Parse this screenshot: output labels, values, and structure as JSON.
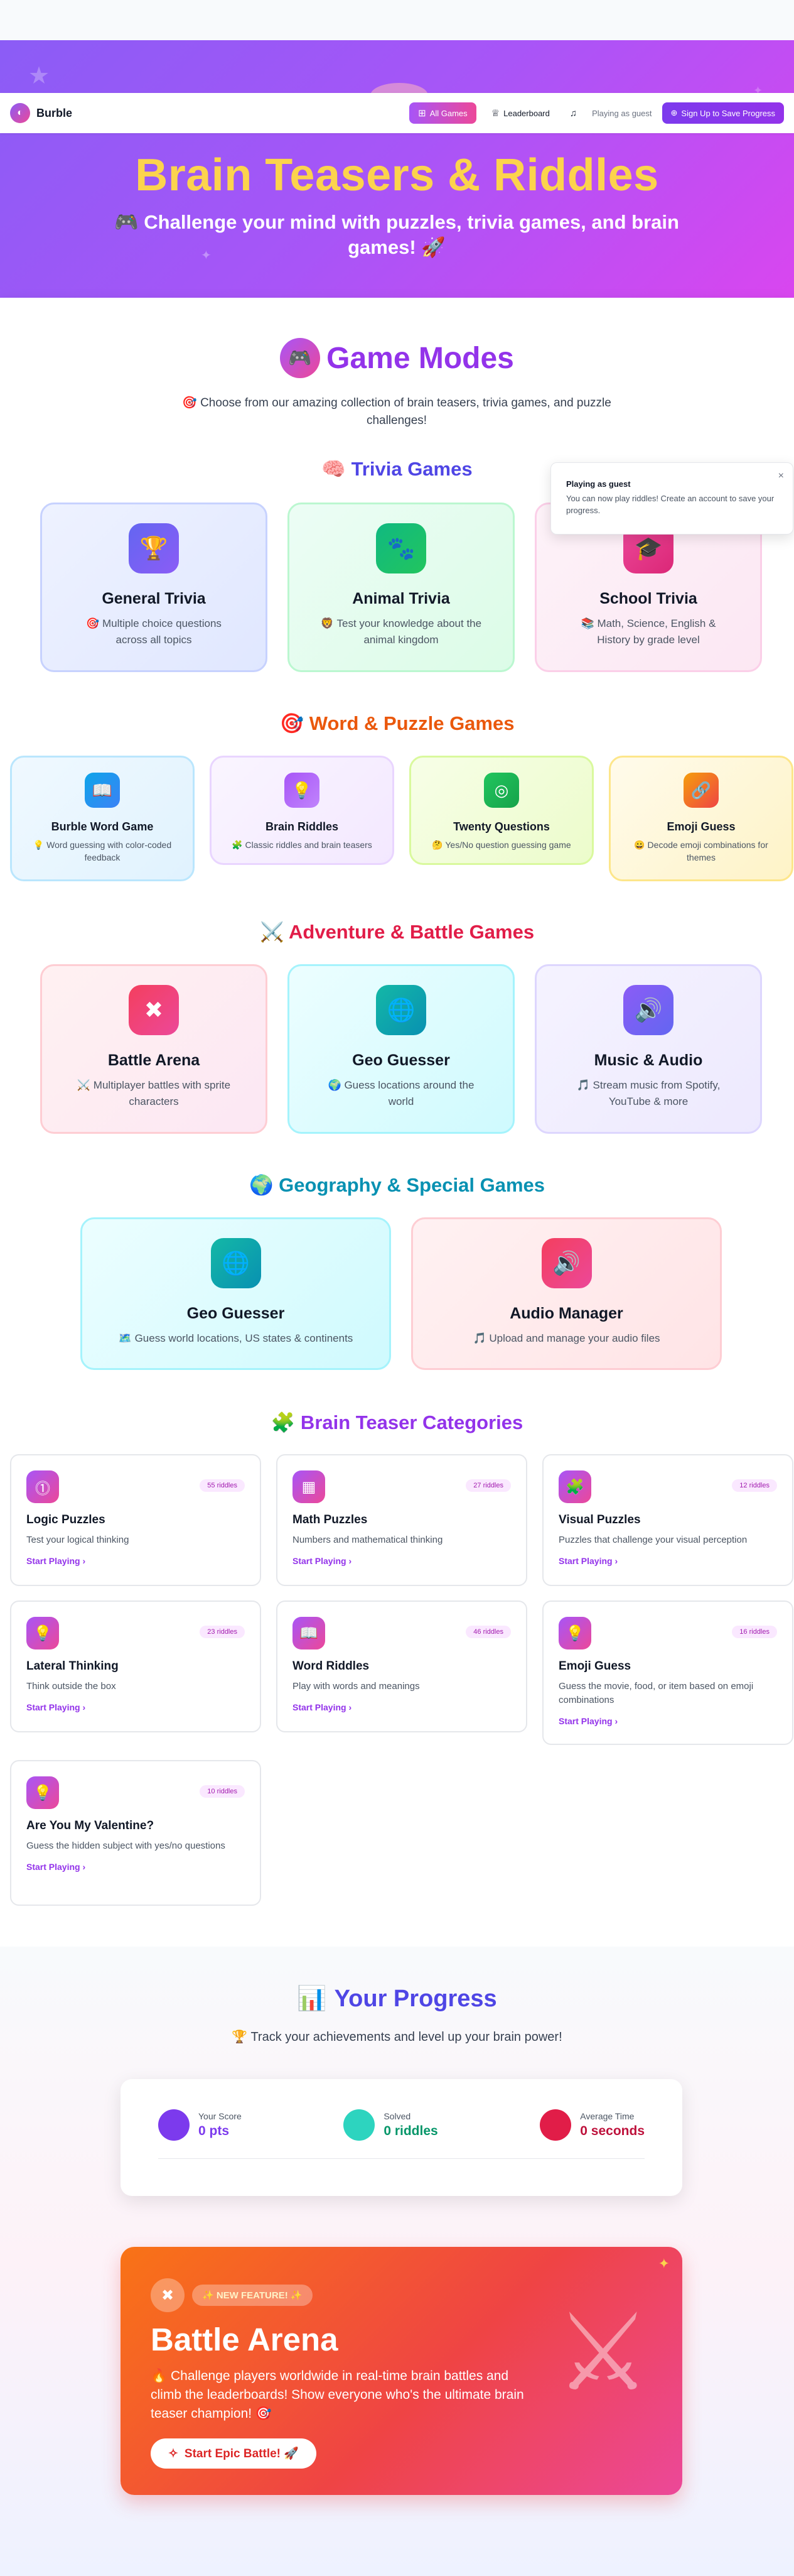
{
  "nav": {
    "brand": "Burble",
    "all_games": "All Games",
    "leaderboard": "Leaderboard",
    "guest": "Playing as guest",
    "signup": "Sign Up to Save Progress"
  },
  "hero": {
    "title": "Brain Teasers & Riddles",
    "subtitle": "🎮 Challenge your mind with puzzles, trivia games, and brain games! 🚀"
  },
  "game_modes": {
    "title": "Game Modes",
    "desc": "🎯 Choose from our amazing collection of brain teasers, trivia games, and puzzle challenges!"
  },
  "toast": {
    "title": "Playing as guest",
    "message": "You can now play riddles! Create an account to save your progress.",
    "close": "×"
  },
  "trivia": {
    "title": "🧠 Trivia Games",
    "cards": [
      {
        "name": "General Trivia",
        "desc": "🎯 Multiple choice questions across all topics",
        "icon": "🏆"
      },
      {
        "name": "Animal Trivia",
        "desc": "🦁 Test your knowledge about the animal kingdom",
        "icon": "🐾"
      },
      {
        "name": "School Trivia",
        "desc": "📚 Math, Science, English & History by grade level",
        "icon": "🎓"
      }
    ]
  },
  "word": {
    "title": "🎯 Word & Puzzle Games",
    "cards": [
      {
        "name": "Burble Word Game",
        "desc": "💡 Word guessing with color-coded feedback",
        "icon": "📖"
      },
      {
        "name": "Brain Riddles",
        "desc": "🧩 Classic riddles and brain teasers",
        "icon": "💡"
      },
      {
        "name": "Twenty Questions",
        "desc": "🤔 Yes/No question guessing game",
        "icon": "◎"
      },
      {
        "name": "Emoji Guess",
        "desc": "😀 Decode emoji combinations for themes",
        "icon": "🔗"
      }
    ]
  },
  "adventure": {
    "title": "⚔️ Adventure & Battle Games",
    "cards": [
      {
        "name": "Battle Arena",
        "desc": "⚔️ Multiplayer battles with sprite characters",
        "icon": "✖"
      },
      {
        "name": "Geo Guesser",
        "desc": "🌍 Guess locations around the world",
        "icon": "🌐"
      },
      {
        "name": "Music & Audio",
        "desc": "🎵 Stream music from Spotify, YouTube & more",
        "icon": "🔊"
      }
    ]
  },
  "geo": {
    "title": "🌍 Geography & Special Games",
    "cards": [
      {
        "name": "Geo Guesser",
        "desc": "🗺️ Guess world locations, US states & continents",
        "icon": "🌐"
      },
      {
        "name": "Audio Manager",
        "desc": "🎵 Upload and manage your audio files",
        "icon": "🔊"
      }
    ]
  },
  "categories": {
    "title": "🧩 Brain Teaser Categories",
    "start": "Start Playing  ›",
    "items": [
      {
        "name": "Logic Puzzles",
        "desc": "Test your logical thinking",
        "count": "55 riddles",
        "icon": "⓵"
      },
      {
        "name": "Math Puzzles",
        "desc": "Numbers and mathematical thinking",
        "count": "27 riddles",
        "icon": "▦"
      },
      {
        "name": "Visual Puzzles",
        "desc": "Puzzles that challenge your visual perception",
        "count": "12 riddles",
        "icon": "🧩"
      },
      {
        "name": "Lateral Thinking",
        "desc": "Think outside the box",
        "count": "23 riddles",
        "icon": "💡"
      },
      {
        "name": "Word Riddles",
        "desc": "Play with words and meanings",
        "count": "46 riddles",
        "icon": "📖"
      },
      {
        "name": "Emoji Guess",
        "desc": "Guess the movie, food, or item based on emoji combinations",
        "count": "16 riddles",
        "icon": "💡"
      },
      {
        "name": "Are You My Valentine?",
        "desc": "Guess the hidden subject with yes/no questions",
        "count": "10 riddles",
        "icon": "💡"
      }
    ]
  },
  "progress": {
    "title": "Your Progress",
    "icon": "📊",
    "subtitle": "🏆 Track your achievements and level up your brain power!",
    "stats": [
      {
        "label": "Your Score",
        "value": "0 pts",
        "color": "#7c3aed"
      },
      {
        "label": "Solved",
        "value": "0 riddles",
        "color": "#2dd4bf"
      },
      {
        "label": "Average Time",
        "value": "0 seconds",
        "color": "#e11d48"
      }
    ]
  },
  "battle": {
    "badge": "✨ NEW FEATURE! ✨",
    "title": "Battle Arena",
    "desc": "🔥 Challenge players worldwide in real-time brain battles and climb the leaderboards! Show everyone who's the ultimate brain teaser champion! 🎯",
    "button": "Start Epic Battle! 🚀"
  }
}
